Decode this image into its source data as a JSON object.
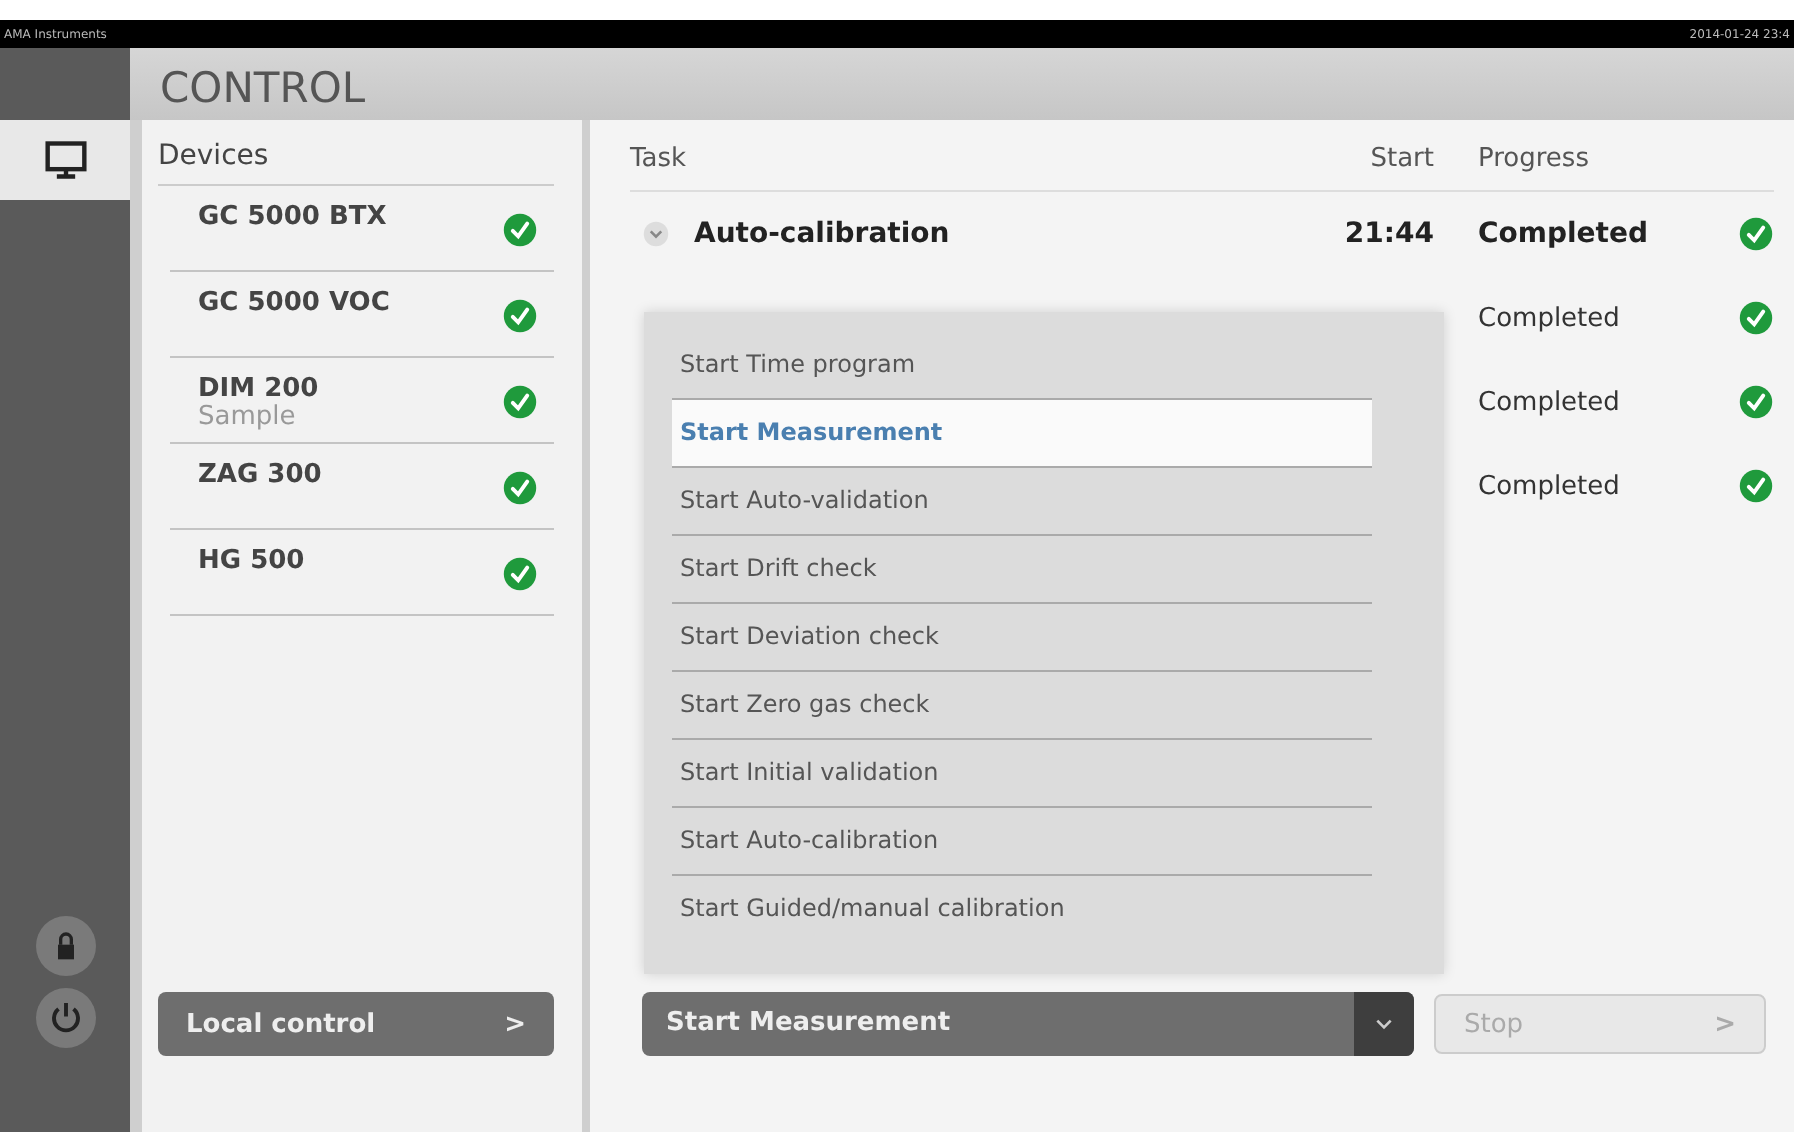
{
  "top_bar": {
    "brand": "AMA Instruments",
    "datetime": "2014-01-24 23:4"
  },
  "header": {
    "title": "CONTROL"
  },
  "rail": [
    {
      "kind": "monitor",
      "selected": true
    },
    {
      "kind": "lock",
      "selected": false
    },
    {
      "kind": "power",
      "selected": false
    }
  ],
  "devices": {
    "title": "Devices",
    "items": [
      {
        "name": "GC 5000 BTX",
        "ok": true
      },
      {
        "name": "GC 5000 VOC",
        "ok": true
      },
      {
        "name": "DIM 200",
        "sub": "Sample",
        "ok": true
      },
      {
        "name": "ZAG 300",
        "ok": true
      },
      {
        "name": "HG 500",
        "ok": true
      }
    ],
    "button": {
      "label": "Local control",
      "arrow": ">"
    }
  },
  "tasks": {
    "columns": [
      "Task",
      "Start",
      "Progress"
    ],
    "rows": [
      {
        "name": "Auto-calibration",
        "start": "21:44",
        "progress": "Completed",
        "ok": true,
        "expanded": false
      },
      {
        "progress": "Completed",
        "ok": true
      },
      {
        "progress": "Completed",
        "ok": true
      },
      {
        "progress": "Completed",
        "ok": true
      }
    ]
  },
  "start_menu": {
    "expanded": true,
    "options": [
      {
        "label": "Start Time program",
        "selected": false
      },
      {
        "label": "Start Measurement",
        "selected": true
      },
      {
        "label": "Start Auto-validation",
        "selected": false
      },
      {
        "label": "Start Drift check",
        "selected": false
      },
      {
        "label": "Start Deviation check",
        "selected": false
      },
      {
        "label": "Start Zero gas check",
        "selected": false
      },
      {
        "label": "Start Initial validation",
        "selected": false
      },
      {
        "label": "Start Auto-calibration",
        "selected": false
      },
      {
        "label": "Start Guided/manual calibration",
        "selected": false
      }
    ],
    "value": "Start Measurement"
  },
  "stop_button": {
    "label": "Stop",
    "arrow": ">",
    "disabled": true
  }
}
